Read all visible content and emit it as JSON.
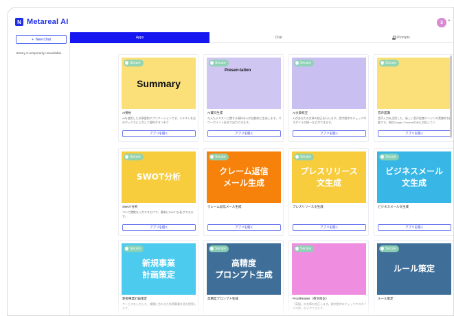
{
  "app": {
    "brand": "Metareal AI",
    "logo_letter": "N",
    "avatar_letter": "3",
    "avatar_name": "N…"
  },
  "sidebar": {
    "new_chat": "New Chat",
    "history_note": "History is temporarily unavailable."
  },
  "tabs": [
    {
      "label": "Apps"
    },
    {
      "label": "Chat"
    },
    {
      "label": "Prompts"
    }
  ],
  "secure_label": "Secure",
  "open_label": "アプリを開く",
  "colors": {
    "accent": "#1616f0",
    "brand": "#1d2ee6",
    "secure_badge": "#8cd2b4"
  },
  "cards": [
    {
      "title": "AI要約",
      "desc": "AIを使用した文章要約アプリケーションです。テキストを左のボックスに入力して要約ボタンをク",
      "thumb_text": "Summary",
      "thumb_bg": "#fbe07a",
      "thumb_fg": "#111111",
      "icon": "summary-illustration"
    },
    {
      "title": "AI資料生成",
      "desc": "与えたテキストに関する資料をAIが自動的に生成します。パワーポイント形式で出力できます。",
      "thumb_text": "Presen-tation",
      "thumb_bg": "#cfc6f2",
      "thumb_fg": "#111111",
      "icon": "presentation-illustration"
    },
    {
      "title": "AI文章校正",
      "desc": "AIがあなたの文章の校正を行います。誤字脱字のチェックやスタイルの統一などができます。",
      "thumb_text": "",
      "thumb_bg": "#c9bff0",
      "thumb_fg": "#111111",
      "icon": "proofreading-illustration"
    },
    {
      "title": "音声認識",
      "desc": "音声入力を活用した、新しい音声認識エンジンの実験的な機能です。現在Google Chromeのみに対応してい",
      "thumb_text": "",
      "thumb_bg": "#fbe07a",
      "thumb_fg": "#111111",
      "icon": "speech-illustration"
    },
    {
      "title": "SWOT分析",
      "desc": "ついて関数を入力するだけで、簡単にSWOT分析ができます。",
      "thumb_text": "SWOT分析",
      "thumb_bg": "#f7cd3e",
      "thumb_fg": "#ffffff",
      "icon": ""
    },
    {
      "title": "クレーム返信メール生成",
      "desc": "",
      "thumb_text": "クレーム返信\nメール生成",
      "thumb_bg": "#f7820b",
      "thumb_fg": "#ffffff",
      "icon": ""
    },
    {
      "title": "プレスリリース文生成",
      "desc": "",
      "thumb_text": "プレスリリース\n文生成",
      "thumb_bg": "#f7cd3e",
      "thumb_fg": "#ffffff",
      "icon": ""
    },
    {
      "title": "ビジネスメール文生成",
      "desc": "",
      "thumb_text": "ビジネスメール\n文生成",
      "thumb_bg": "#38b6e6",
      "thumb_fg": "#ffffff",
      "icon": ""
    },
    {
      "title": "新規事業計画策定",
      "desc": "サービスを入力した、課題に合わせた新規事業計画を提案します。",
      "thumb_text": "新規事業\n計画策定",
      "thumb_bg": "#4ccbef",
      "thumb_fg": "#ffffff",
      "icon": ""
    },
    {
      "title": "高精度プロンプト生成",
      "desc": "",
      "thumb_text": "高精度\nプロンプト生成",
      "thumb_bg": "#3f6f99",
      "thumb_fg": "#ffffff",
      "icon": ""
    },
    {
      "title": "ProofReader（英文校正）",
      "desc": "「英語」の文章を校正します。誤字脱字のチェックやスタイルの統一などができます。",
      "thumb_text": "",
      "thumb_bg": "#ef8de0",
      "thumb_fg": "#111111",
      "icon": "proofreader-illustration"
    },
    {
      "title": "ルール策定",
      "desc": "",
      "thumb_text": "ルール策定",
      "thumb_bg": "#3f6f99",
      "thumb_fg": "#ffffff",
      "icon": ""
    }
  ]
}
